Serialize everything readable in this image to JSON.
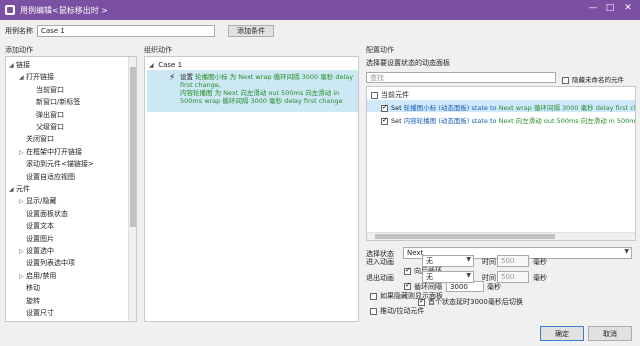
{
  "window": {
    "title": "用例编辑<鼠标移出时 >"
  },
  "casename": {
    "label": "用例名称",
    "value": "Case 1",
    "add_condition": "添加条件"
  },
  "sections": {
    "add_action": "添加动作",
    "organize": "组织动作",
    "configure": "配置动作"
  },
  "actions_tree": [
    {
      "text": "链接",
      "indent": 0,
      "arrow": "down"
    },
    {
      "text": "打开链接",
      "indent": 1,
      "arrow": "down"
    },
    {
      "text": "当前窗口",
      "indent": 2,
      "arrow": ""
    },
    {
      "text": "新窗口/新标签",
      "indent": 2,
      "arrow": ""
    },
    {
      "text": "弹出窗口",
      "indent": 2,
      "arrow": ""
    },
    {
      "text": "父级窗口",
      "indent": 2,
      "arrow": ""
    },
    {
      "text": "关闭窗口",
      "indent": 1,
      "arrow": ""
    },
    {
      "text": "在框架中打开链接",
      "indent": 1,
      "arrow": "right"
    },
    {
      "text": "滚动到元件<锚链接>",
      "indent": 1,
      "arrow": ""
    },
    {
      "text": "设置自适应视图",
      "indent": 1,
      "arrow": ""
    },
    {
      "text": "元件",
      "indent": 0,
      "arrow": "down"
    },
    {
      "text": "显示/隐藏",
      "indent": 1,
      "arrow": "right"
    },
    {
      "text": "设置面板状态",
      "indent": 1,
      "arrow": ""
    },
    {
      "text": "设置文本",
      "indent": 1,
      "arrow": ""
    },
    {
      "text": "设置图片",
      "indent": 1,
      "arrow": ""
    },
    {
      "text": "设置选中",
      "indent": 1,
      "arrow": "right"
    },
    {
      "text": "设置列表选中项",
      "indent": 1,
      "arrow": ""
    },
    {
      "text": "启用/禁用",
      "indent": 1,
      "arrow": "right"
    },
    {
      "text": "移动",
      "indent": 1,
      "arrow": ""
    },
    {
      "text": "旋转",
      "indent": 1,
      "arrow": ""
    },
    {
      "text": "设置尺寸",
      "indent": 1,
      "arrow": ""
    }
  ],
  "organize": {
    "case_label": "Case 1",
    "action_line1_prefix": "设置 ",
    "action_line1_green": "轮播图小标 为 Next wrap 循环间隔 3000 毫秒 delay first change,",
    "action_line2_green": "内容轮播图 为 Next 向左滑动 out 500ms 向左滑动 in 500ms wrap 循环间隔 3000 毫秒 delay first change"
  },
  "configure": {
    "select_panel_title": "选择要设置状态的动态面板",
    "search_placeholder": "查找",
    "hide_unnamed": "隐藏未命名的元件",
    "current_element": "当前元件",
    "rows": [
      {
        "prefix": "Set ",
        "blue": "轮播图小标 (动态面板) state to ",
        "green": "Next wrap 循环间隔 3000 毫秒 delay first change"
      },
      {
        "prefix": "Set ",
        "blue": "内容轮播图 (动态面板) state to ",
        "green": "Next 向左滑动 out 500ms 向左滑动 in 500ms w"
      }
    ],
    "select_state_label": "选择状态",
    "select_state_value": "Next",
    "loop_back": "向后循环",
    "loop_interval": "循环间隔",
    "interval_value": "3000",
    "interval_unit": "毫秒",
    "first_delay": "首个状态延时3000毫秒后切换",
    "enter_anim": "进入动画",
    "exit_anim": "退出动画",
    "anim_none": "无",
    "time_label": "时间",
    "time_value": "500",
    "ms": "毫秒",
    "show_if_hidden": "如果隐藏则显示面板",
    "push_widgets": "推动/拉动元件"
  },
  "footer": {
    "ok": "确定",
    "cancel": "取消"
  }
}
